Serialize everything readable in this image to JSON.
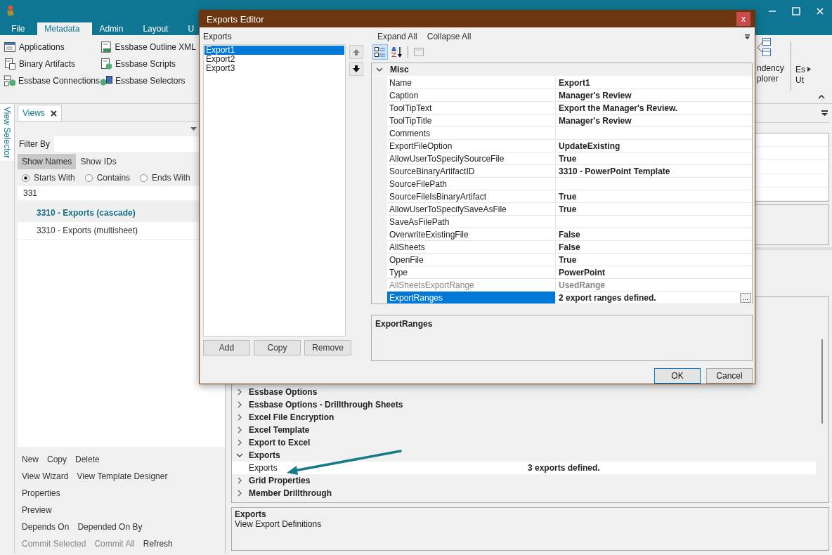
{
  "menu_tabs": [
    {
      "label": "File",
      "selected": false
    },
    {
      "label": "Metadata",
      "selected": true
    },
    {
      "label": "Admin",
      "selected": false
    },
    {
      "label": "Layout",
      "selected": false
    },
    {
      "label": "U",
      "selected": false
    }
  ],
  "ribbon": {
    "items": [
      {
        "label": "Applications"
      },
      {
        "label": "Binary Artifacts"
      },
      {
        "label": "Essbase Connections"
      },
      {
        "label": "Essbase Outline XML"
      },
      {
        "label": "Essbase Scripts"
      },
      {
        "label": "Essbase Selectors"
      }
    ],
    "cut_buttons": [
      {
        "lines": [
          "ndency",
          "plorer"
        ]
      },
      {
        "lines": [
          "Es",
          "Ut"
        ]
      }
    ]
  },
  "side_tab": "View Selector",
  "views_panel": {
    "tab": "Views",
    "filter_label": "Filter By",
    "display_modes": [
      {
        "label": "Show Names",
        "selected": true
      },
      {
        "label": "Show IDs",
        "selected": false
      }
    ],
    "match_options": [
      {
        "label": "Starts With",
        "selected": true
      },
      {
        "label": "Contains",
        "selected": false
      },
      {
        "label": "Ends With",
        "selected": false
      }
    ],
    "search_value": "331",
    "results": [
      {
        "label": "3310 - Exports (cascade)",
        "selected": true
      },
      {
        "label": "3310 - Exports (multisheet)",
        "selected": false
      }
    ],
    "actions": [
      [
        {
          "label": "New",
          "disabled": false
        },
        {
          "label": "Copy",
          "disabled": false
        },
        {
          "label": "Delete",
          "disabled": false
        }
      ],
      [
        {
          "label": "View Wizard",
          "disabled": false
        },
        {
          "label": "View Template Designer",
          "disabled": false
        }
      ],
      [
        {
          "label": "Properties",
          "disabled": false
        }
      ],
      [
        {
          "label": "Preview",
          "disabled": false
        }
      ],
      [
        {
          "label": "Depends On",
          "disabled": false
        },
        {
          "label": "Depended On By",
          "disabled": false
        }
      ],
      [
        {
          "label": "Commit Selected",
          "disabled": true
        },
        {
          "label": "Commit All",
          "disabled": true
        },
        {
          "label": "Refresh",
          "disabled": false
        }
      ]
    ]
  },
  "properties_tree": {
    "items": [
      {
        "label": "Essbase Options",
        "expanded": false
      },
      {
        "label": "Essbase Options - Drillthrough Sheets",
        "expanded": false
      },
      {
        "label": "Excel File Encryption",
        "expanded": false
      },
      {
        "label": "Excel Template",
        "expanded": false
      },
      {
        "label": "Export to Excel",
        "expanded": false
      },
      {
        "label": "Exports",
        "expanded": true,
        "children": [
          {
            "name": "Exports",
            "value": "3 exports defined."
          }
        ]
      },
      {
        "label": "Grid Properties",
        "expanded": false
      },
      {
        "label": "Member Drillthrough",
        "expanded": false
      }
    ]
  },
  "description": {
    "title": "Exports",
    "text": "View Export Definitions"
  },
  "dialog": {
    "title": "Exports Editor",
    "close": "x",
    "list_label": "Exports",
    "exports": [
      {
        "label": "Export1",
        "selected": true
      },
      {
        "label": "Export2",
        "selected": false
      },
      {
        "label": "Export3",
        "selected": false
      }
    ],
    "list_buttons": [
      "Add",
      "Copy",
      "Remove"
    ],
    "toolbar": [
      "Expand All",
      "Collapse All"
    ],
    "view_buttons": [
      {
        "kind": "categorized",
        "selected": true
      },
      {
        "kind": "alphabetical",
        "selected": false
      },
      {
        "kind": "pages",
        "selected": false
      }
    ],
    "category": {
      "label": "Misc",
      "expanded": true
    },
    "properties": [
      {
        "name": "Name",
        "value": "Export1",
        "disabled": false,
        "selected": false
      },
      {
        "name": "Caption",
        "value": "Manager's Review",
        "disabled": false,
        "selected": false
      },
      {
        "name": "ToolTipText",
        "value": "Export the Manager's Review.",
        "disabled": false,
        "selected": false
      },
      {
        "name": "ToolTipTitle",
        "value": "Manager's Review",
        "disabled": false,
        "selected": false
      },
      {
        "name": "Comments",
        "disabled": false,
        "selected": false
      },
      {
        "name": "ExportFileOption",
        "value": "UpdateExisting",
        "disabled": false,
        "selected": false
      },
      {
        "name": "AllowUserToSpecifySourceFile",
        "value": "True",
        "disabled": false,
        "selected": false
      },
      {
        "name": "SourceBinaryArtifactID",
        "value": "3310 - PowerPoint Template",
        "disabled": false,
        "selected": false
      },
      {
        "name": "SourceFilePath",
        "disabled": false,
        "selected": false
      },
      {
        "name": "SourceFileIsBinaryArtifact",
        "value": "True",
        "disabled": false,
        "selected": false
      },
      {
        "name": "AllowUserToSpecifySaveAsFile",
        "value": "True",
        "disabled": false,
        "selected": false
      },
      {
        "name": "SaveAsFilePath",
        "disabled": false,
        "selected": false
      },
      {
        "name": "OverwriteExistingFile",
        "value": "False",
        "disabled": false,
        "selected": false
      },
      {
        "name": "AllSheets",
        "value": "False",
        "disabled": false,
        "selected": false
      },
      {
        "name": "OpenFile",
        "value": "True",
        "disabled": false,
        "selected": false
      },
      {
        "name": "Type",
        "value": "PowerPoint",
        "disabled": false,
        "selected": false
      },
      {
        "name": "AllSheetsExportRange",
        "value": "UsedRange",
        "disabled": true,
        "selected": false
      },
      {
        "name": "ExportRanges",
        "value": "2 export ranges defined.",
        "disabled": false,
        "selected": true,
        "button": "..."
      }
    ],
    "help_title": "ExportRanges",
    "buttons": [
      "OK",
      "Cancel"
    ]
  }
}
